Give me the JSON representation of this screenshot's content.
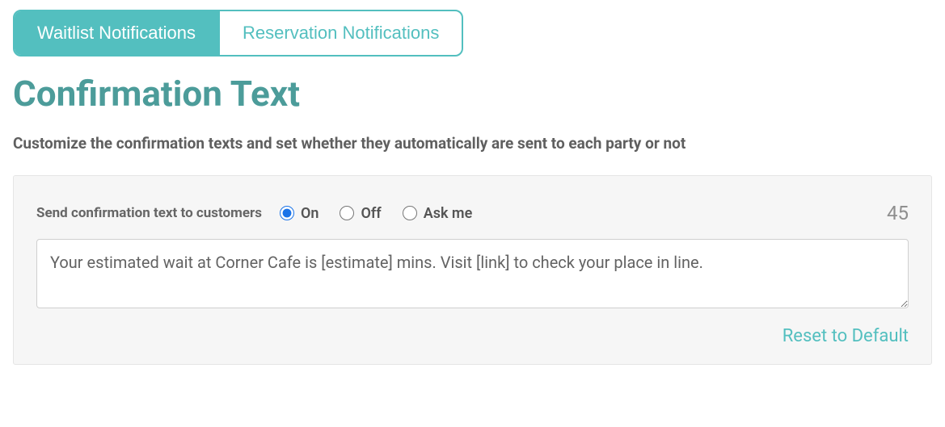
{
  "tabs": {
    "items": [
      {
        "label": "Waitlist Notifications",
        "active": true
      },
      {
        "label": "Reservation Notifications",
        "active": false
      }
    ]
  },
  "heading": "Confirmation Text",
  "subheading": "Customize the confirmation texts and set whether they automatically are sent to each party or not",
  "panel": {
    "fieldLabel": "Send confirmation text to customers",
    "options": {
      "on": "On",
      "off": "Off",
      "askme": "Ask me"
    },
    "selected": "on",
    "counter": "45",
    "messageText": "Your estimated wait at Corner Cafe is [estimate] mins. Visit [link] to check your place in line.",
    "resetLabel": "Reset to Default"
  }
}
